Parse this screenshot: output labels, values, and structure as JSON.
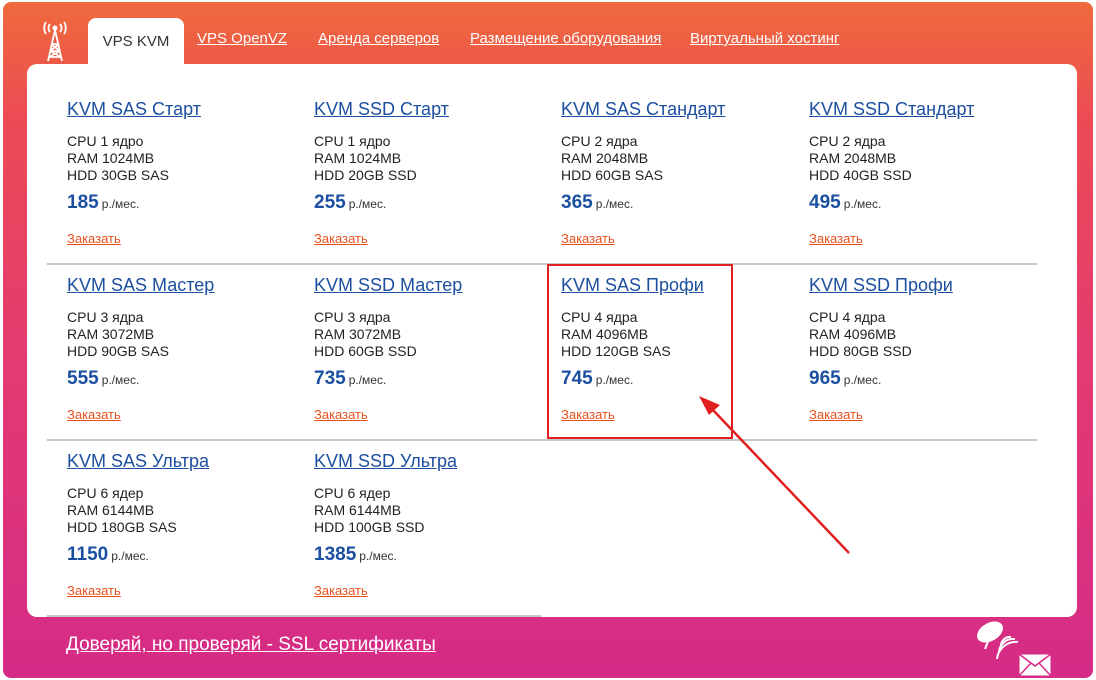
{
  "tabs": [
    {
      "label": "VPS KVM",
      "active": true
    },
    {
      "label": "VPS OpenVZ",
      "active": false
    },
    {
      "label": "Аренда серверов",
      "active": false
    },
    {
      "label": "Размещение оборудования",
      "active": false
    },
    {
      "label": "Виртуальный хостинг",
      "active": false
    }
  ],
  "plans": [
    {
      "name": "KVM SAS Старт",
      "cpu": "CPU 1 ядро",
      "ram": "RAM 1024MB",
      "hdd": "HDD 30GB SAS",
      "price": "185",
      "unit": "р./мес.",
      "order": "Заказать"
    },
    {
      "name": "KVM SSD Старт",
      "cpu": "CPU 1 ядро",
      "ram": "RAM 1024MB",
      "hdd": "HDD 20GB SSD",
      "price": "255",
      "unit": "р./мес.",
      "order": "Заказать"
    },
    {
      "name": "KVM SAS Стандарт",
      "cpu": "CPU 2 ядра",
      "ram": "RAM 2048MB",
      "hdd": "HDD 60GB SAS",
      "price": "365",
      "unit": "р./мес.",
      "order": "Заказать"
    },
    {
      "name": "KVM SSD Стандарт",
      "cpu": "CPU 2 ядра",
      "ram": "RAM 2048MB",
      "hdd": "HDD 40GB SSD",
      "price": "495",
      "unit": "р./мес.",
      "order": "Заказать"
    },
    {
      "name": "KVM SAS Мастер",
      "cpu": "CPU 3 ядра",
      "ram": "RAM 3072MB",
      "hdd": "HDD 90GB SAS",
      "price": "555",
      "unit": "р./мес.",
      "order": "Заказать"
    },
    {
      "name": "KVM SSD Мастер",
      "cpu": "CPU 3 ядра",
      "ram": "RAM 3072MB",
      "hdd": "HDD 60GB SSD",
      "price": "735",
      "unit": "р./мес.",
      "order": "Заказать"
    },
    {
      "name": "KVM SAS Профи",
      "cpu": "CPU 4 ядра",
      "ram": "RAM 4096MB",
      "hdd": "HDD 120GB SAS",
      "price": "745",
      "unit": "р./мес.",
      "order": "Заказать"
    },
    {
      "name": "KVM SSD Профи",
      "cpu": "CPU 4 ядра",
      "ram": "RAM 4096MB",
      "hdd": "HDD 80GB SSD",
      "price": "965",
      "unit": "р./мес.",
      "order": "Заказать"
    },
    {
      "name": "KVM SAS Ультра",
      "cpu": "CPU 6 ядер",
      "ram": "RAM 6144MB",
      "hdd": "HDD 180GB SAS",
      "price": "1150",
      "unit": "р./мес.",
      "order": "Заказать"
    },
    {
      "name": "KVM SSD Ультра",
      "cpu": "CPU 6 ядер",
      "ram": "RAM 6144MB",
      "hdd": "HDD 100GB SSD",
      "price": "1385",
      "unit": "р./мес.",
      "order": "Заказать"
    }
  ],
  "footer": {
    "ssl_link": "Доверяй, но проверяй - SSL сертификаты"
  },
  "icons": {
    "antenna": "antenna-tower-icon",
    "satellite": "satellite-dish-icon",
    "mail": "envelope-icon"
  },
  "colors": {
    "accent": "#1b4fa0",
    "order_link": "#e8501e",
    "highlight": "#e02020",
    "bg_top": "#ef6a3c",
    "bg_bottom": "#d52b87"
  }
}
